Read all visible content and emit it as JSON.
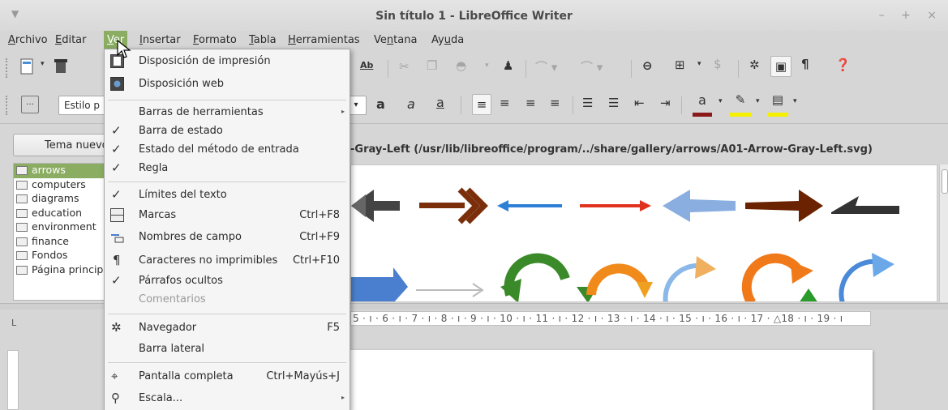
{
  "window": {
    "title": "Sin título 1 - LibreOffice Writer",
    "controls": [
      "–",
      "+",
      "×"
    ]
  },
  "menubar": {
    "items": [
      {
        "label": "Archivo",
        "u": "A"
      },
      {
        "label": "Editar",
        "u": "E"
      },
      {
        "label": "Ver",
        "u": "V",
        "active": true
      },
      {
        "label": "Insertar",
        "u": "I"
      },
      {
        "label": "Formato",
        "u": "F"
      },
      {
        "label": "Tabla",
        "u": "T"
      },
      {
        "label": "Herramientas",
        "u": "H"
      },
      {
        "label": "Ventana",
        "u": "n"
      },
      {
        "label": "Ayuda",
        "u": "u"
      }
    ]
  },
  "toolbar2": {
    "style_box_value": "Estilo p"
  },
  "gallery": {
    "new_theme_label": "Tema nuevo...",
    "path": "-Gray-Left (/usr/lib/libreoffice/program/../share/gallery/arrows/A01-Arrow-Gray-Left.svg)",
    "themes": [
      "arrows",
      "computers",
      "diagrams",
      "education",
      "environment",
      "finance",
      "Fondos",
      "Página principal"
    ],
    "selected_theme": "arrows"
  },
  "ruler": {
    "text": "5 · ı · 6 · ı · 7 · ı · 8 · ı · 9 · ı · 10 · ı · 11 · ı · 12 · ı · 13 · ı · 14 · ı · 15 · ı · 16 · ı · 17 · △18 · ı · 19 · ı"
  },
  "view_menu": {
    "items": [
      {
        "label": "Disposición de impresión",
        "check": "",
        "icon": "print-layout-icon"
      },
      {
        "label": "Disposición web",
        "check": "",
        "icon": "web-layout-icon"
      },
      {
        "label": "Barras de herramientas",
        "submenu": true
      },
      {
        "label": "Barra de estado",
        "check": "✓"
      },
      {
        "label": "Estado del método de entrada",
        "check": "✓"
      },
      {
        "label": "Regla",
        "check": "✓"
      },
      {
        "label": "Límites del texto",
        "check": "✓"
      },
      {
        "label": "Marcas",
        "shortcut": "Ctrl+F8",
        "icon": "marks-icon"
      },
      {
        "label": "Nombres de campo",
        "shortcut": "Ctrl+F9",
        "icon": "field-names-icon"
      },
      {
        "label": "Caracteres no imprimibles",
        "shortcut": "Ctrl+F10",
        "icon": "pilcrow-icon"
      },
      {
        "label": "Párrafos ocultos",
        "check": "✓"
      },
      {
        "label": "Comentarios",
        "disabled": true
      },
      {
        "label": "Navegador",
        "shortcut": "F5",
        "icon": "navigator-icon"
      },
      {
        "label": "Barra lateral"
      },
      {
        "label": "Pantalla completa",
        "shortcut": "Ctrl+Mayús+J",
        "icon": "fullscreen-icon"
      },
      {
        "label": "Escala...",
        "submenu": true,
        "icon": "zoom-icon"
      }
    ]
  }
}
